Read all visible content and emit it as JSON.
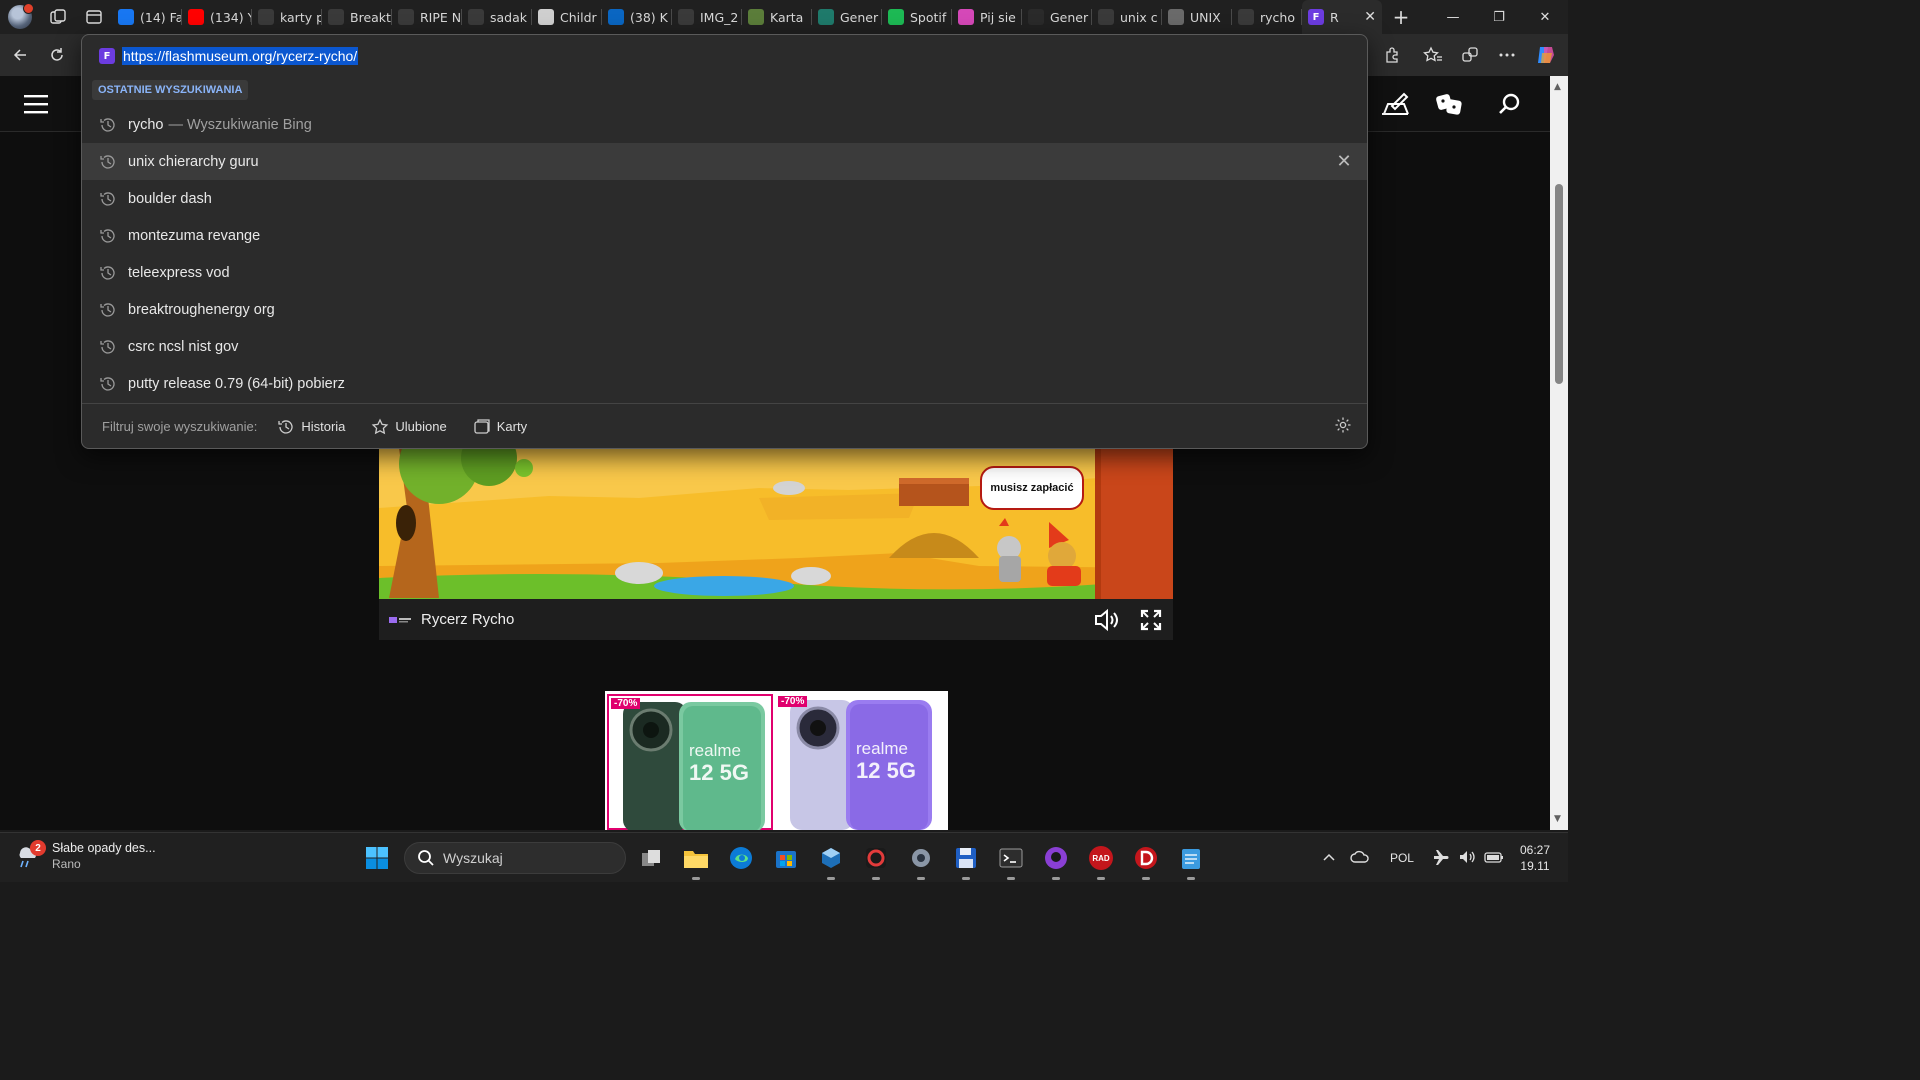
{
  "colors": {
    "accent": "#0b57d0",
    "tab_bg": "#202020",
    "toolbar_bg": "#2b2b2b",
    "game_sky": "#f5b31f",
    "ad_badge": "#e0006e"
  },
  "tabs": [
    {
      "label": "(14) Fa",
      "icon": "facebook-icon",
      "color": "#1877f2"
    },
    {
      "label": "(134) Y",
      "icon": "youtube-icon",
      "color": "#ff0000"
    },
    {
      "label": "karty p",
      "icon": "search-icon",
      "color": "#3a3a3a"
    },
    {
      "label": "Breakt",
      "icon": "gear-icon",
      "color": "#3a3a3a"
    },
    {
      "label": "RIPE N",
      "icon": "ripe-icon",
      "color": "#3a3a3a"
    },
    {
      "label": "sadak",
      "icon": "search-icon",
      "color": "#3a3a3a"
    },
    {
      "label": "Childr",
      "icon": "wikipedia-icon",
      "color": "#cfcfcf"
    },
    {
      "label": "(38) K",
      "icon": "linkedin-icon",
      "color": "#0a66c2"
    },
    {
      "label": "IMG_2",
      "icon": "globe-icon",
      "color": "#3a3a3a"
    },
    {
      "label": "Karta",
      "icon": "n-icon",
      "color": "#5b7d3a"
    },
    {
      "label": "Gener",
      "icon": "diamond-icon",
      "color": "#1f7a6b"
    },
    {
      "label": "Spotif",
      "icon": "spotify-icon",
      "color": "#1db954"
    },
    {
      "label": "Pij sie",
      "icon": "colorful-icon",
      "color": "#d548b8"
    },
    {
      "label": "Gener",
      "icon": "openai-icon",
      "color": "#2a2a2a"
    },
    {
      "label": "unix c",
      "icon": "search-icon",
      "color": "#3a3a3a"
    },
    {
      "label": "UNIX",
      "icon": "unix-icon",
      "color": "#6a6a6a"
    },
    {
      "label": "rycho",
      "icon": "search-icon",
      "color": "#3a3a3a"
    }
  ],
  "active_tab": {
    "label": "R",
    "icon": "flashmuseum-icon",
    "close": "✕"
  },
  "new_tab_label": "+",
  "window": {
    "minimize": "—",
    "maximize": "❐",
    "close": "✕"
  },
  "omnibox": {
    "url": "https://flashmuseum.org/rycerz-rycho/",
    "recent_heading": "OSTATNIE WYSZUKIWANIA",
    "suggestions": [
      {
        "text": "rycho",
        "suffix": "— Wyszukiwanie Bing"
      },
      {
        "text": "unix chierarchy guru",
        "suffix": ""
      },
      {
        "text": "boulder dash",
        "suffix": ""
      },
      {
        "text": "montezuma revange",
        "suffix": ""
      },
      {
        "text": "teleexpress vod",
        "suffix": ""
      },
      {
        "text": "breaktroughenergy org",
        "suffix": ""
      },
      {
        "text": "csrc ncsl nist gov",
        "suffix": ""
      },
      {
        "text": "putty release 0.79 (64-bit) pobierz",
        "suffix": ""
      }
    ],
    "remove_glyph": "✕",
    "filter_label": "Filtruj swoje wyszukiwanie:",
    "filters": [
      "Historia",
      "Ulubione",
      "Karty"
    ]
  },
  "game": {
    "title": "Rycerz Rycho",
    "speech": "musisz zapłacić"
  },
  "ad": {
    "cards": [
      {
        "badge": "-70%",
        "brand": "realme",
        "model": "12 5G"
      },
      {
        "badge": "-70%",
        "brand": "realme",
        "model": "12 5G"
      }
    ]
  },
  "taskbar": {
    "weather_title": "Słabe opady des...",
    "weather_sub": "Rano",
    "weather_badge": "2",
    "search_placeholder": "Wyszukaj",
    "language": "POL",
    "time": "06:27",
    "date": "19.11",
    "rad_label": "RAD"
  }
}
